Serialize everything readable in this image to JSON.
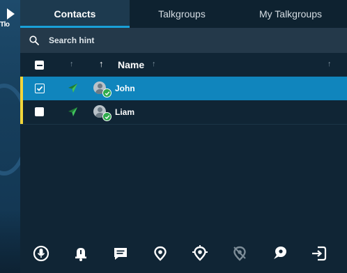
{
  "background_app": {
    "label": "Tlo"
  },
  "tabs": [
    {
      "label": "Contacts",
      "active": true
    },
    {
      "label": "Talkgroups",
      "active": false
    },
    {
      "label": "My Talkgroups",
      "active": false
    }
  ],
  "search": {
    "placeholder": "Search hint",
    "value": ""
  },
  "table": {
    "header": {
      "name_label": "Name",
      "select_all_state": "indeterminate"
    },
    "rows": [
      {
        "name": "John",
        "checked": true,
        "selected": true,
        "status": "online"
      },
      {
        "name": "Liam",
        "checked": false,
        "selected": false,
        "status": "online"
      }
    ]
  },
  "toolbar": {
    "icons": [
      "microphone-icon",
      "bell-alert-icon",
      "message-icon",
      "location-pin-icon",
      "target-location-icon",
      "location-off-icon",
      "pin-check-icon",
      "logout-icon"
    ]
  },
  "colors": {
    "accent_blue": "#1085bd",
    "tab_underline": "#19a0d8",
    "status_green": "#2eab4c",
    "row_marker": "#f2d63a",
    "panel_bg": "#102535"
  }
}
